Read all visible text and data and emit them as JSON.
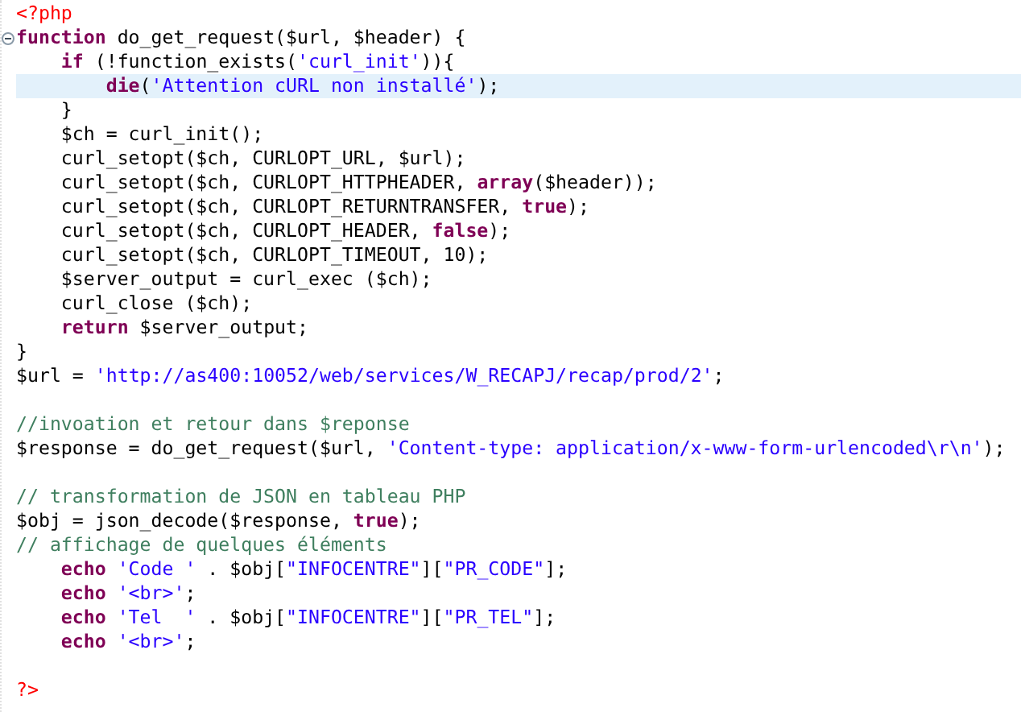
{
  "editor": {
    "lines": [
      {
        "highlighted": false,
        "tokens": [
          {
            "kind": "tag",
            "text": "<?php"
          }
        ]
      },
      {
        "highlighted": false,
        "collapsible": true,
        "tokens": [
          {
            "kind": "keyword",
            "text": "function"
          },
          {
            "kind": "plain",
            "text": " do_get_request($url, $header) {"
          }
        ]
      },
      {
        "highlighted": false,
        "tokens": [
          {
            "kind": "keyword",
            "text": "    if"
          },
          {
            "kind": "plain",
            "text": " (!function_exists("
          },
          {
            "kind": "string",
            "text": "'curl_init'"
          },
          {
            "kind": "plain",
            "text": ")){"
          }
        ]
      },
      {
        "highlighted": true,
        "tokens": [
          {
            "kind": "keyword",
            "text": "        die"
          },
          {
            "kind": "plain",
            "text": "("
          },
          {
            "kind": "string",
            "text": "'Attention cURL non installé'"
          },
          {
            "kind": "plain",
            "text": ");"
          }
        ]
      },
      {
        "highlighted": false,
        "tokens": [
          {
            "kind": "plain",
            "text": "    }"
          }
        ]
      },
      {
        "highlighted": false,
        "tokens": [
          {
            "kind": "plain",
            "text": "    $ch = curl_init();"
          }
        ]
      },
      {
        "highlighted": false,
        "tokens": [
          {
            "kind": "plain",
            "text": "    curl_setopt($ch, CURLOPT_URL, $url);"
          }
        ]
      },
      {
        "highlighted": false,
        "tokens": [
          {
            "kind": "plain",
            "text": "    curl_setopt($ch, CURLOPT_HTTPHEADER, "
          },
          {
            "kind": "keyword",
            "text": "array"
          },
          {
            "kind": "plain",
            "text": "($header));"
          }
        ]
      },
      {
        "highlighted": false,
        "tokens": [
          {
            "kind": "plain",
            "text": "    curl_setopt($ch, CURLOPT_RETURNTRANSFER, "
          },
          {
            "kind": "keyword",
            "text": "true"
          },
          {
            "kind": "plain",
            "text": ");"
          }
        ]
      },
      {
        "highlighted": false,
        "tokens": [
          {
            "kind": "plain",
            "text": "    curl_setopt($ch, CURLOPT_HEADER, "
          },
          {
            "kind": "keyword",
            "text": "false"
          },
          {
            "kind": "plain",
            "text": ");"
          }
        ]
      },
      {
        "highlighted": false,
        "tokens": [
          {
            "kind": "plain",
            "text": "    curl_setopt($ch, CURLOPT_TIMEOUT, 10);"
          }
        ]
      },
      {
        "highlighted": false,
        "tokens": [
          {
            "kind": "plain",
            "text": "    $server_output = curl_exec ($ch);"
          }
        ]
      },
      {
        "highlighted": false,
        "tokens": [
          {
            "kind": "plain",
            "text": "    curl_close ($ch);"
          }
        ]
      },
      {
        "highlighted": false,
        "tokens": [
          {
            "kind": "keyword",
            "text": "    return"
          },
          {
            "kind": "plain",
            "text": " $server_output;"
          }
        ]
      },
      {
        "highlighted": false,
        "tokens": [
          {
            "kind": "plain",
            "text": "}"
          }
        ]
      },
      {
        "highlighted": false,
        "tokens": [
          {
            "kind": "plain",
            "text": "$url = "
          },
          {
            "kind": "string",
            "text": "'http://as400:10052/web/services/W_RECAPJ/recap/prod/2'"
          },
          {
            "kind": "plain",
            "text": ";"
          }
        ]
      },
      {
        "highlighted": false
      },
      {
        "highlighted": false,
        "tokens": [
          {
            "kind": "comment",
            "text": "//invoation et retour dans $reponse"
          }
        ]
      },
      {
        "highlighted": false,
        "tokens": [
          {
            "kind": "plain",
            "text": "$response = do_get_request($url, "
          },
          {
            "kind": "string",
            "text": "'Content-type: application/x-www-form-urlencoded\\r\\n'"
          },
          {
            "kind": "plain",
            "text": ");"
          }
        ]
      },
      {
        "highlighted": false
      },
      {
        "highlighted": false,
        "tokens": [
          {
            "kind": "comment",
            "text": "// transformation de JSON en tableau PHP"
          }
        ]
      },
      {
        "highlighted": false,
        "tokens": [
          {
            "kind": "plain",
            "text": "$obj = json_decode($response, "
          },
          {
            "kind": "keyword",
            "text": "true"
          },
          {
            "kind": "plain",
            "text": ");"
          }
        ]
      },
      {
        "highlighted": false,
        "tokens": [
          {
            "kind": "comment",
            "text": "// affichage de quelques éléments"
          }
        ]
      },
      {
        "highlighted": false,
        "tokens": [
          {
            "kind": "keyword",
            "text": "    echo"
          },
          {
            "kind": "string",
            "text": " 'Code '"
          },
          {
            "kind": "plain",
            "text": " . $obj["
          },
          {
            "kind": "string",
            "text": "\"INFOCENTRE\""
          },
          {
            "kind": "plain",
            "text": "]["
          },
          {
            "kind": "string",
            "text": "\"PR_CODE\""
          },
          {
            "kind": "plain",
            "text": "];"
          }
        ]
      },
      {
        "highlighted": false,
        "tokens": [
          {
            "kind": "keyword",
            "text": "    echo"
          },
          {
            "kind": "string",
            "text": " '<br>'"
          },
          {
            "kind": "plain",
            "text": ";"
          }
        ]
      },
      {
        "highlighted": false,
        "tokens": [
          {
            "kind": "keyword",
            "text": "    echo"
          },
          {
            "kind": "string",
            "text": " 'Tel  '"
          },
          {
            "kind": "plain",
            "text": " . $obj["
          },
          {
            "kind": "string",
            "text": "\"INFOCENTRE\""
          },
          {
            "kind": "plain",
            "text": "]["
          },
          {
            "kind": "string",
            "text": "\"PR_TEL\""
          },
          {
            "kind": "plain",
            "text": "];"
          }
        ]
      },
      {
        "highlighted": false,
        "tokens": [
          {
            "kind": "keyword",
            "text": "    echo"
          },
          {
            "kind": "string",
            "text": " '<br>'"
          },
          {
            "kind": "plain",
            "text": ";"
          }
        ]
      },
      {
        "highlighted": false
      },
      {
        "highlighted": false,
        "tokens": [
          {
            "kind": "tag",
            "text": "?>"
          }
        ]
      }
    ]
  }
}
